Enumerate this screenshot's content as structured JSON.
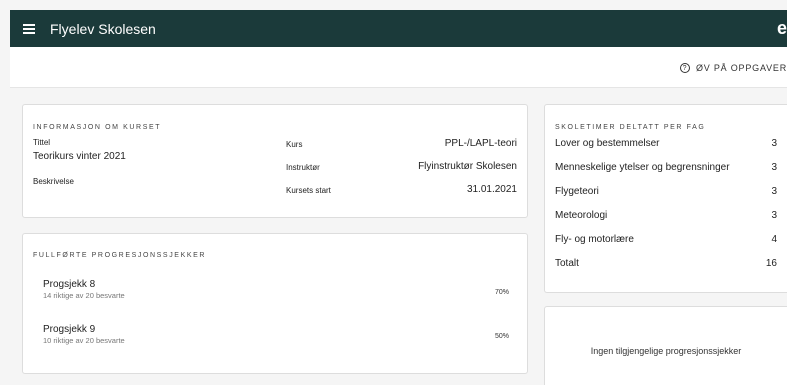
{
  "header": {
    "app_title": "Flyelev Skolesen",
    "logo_letter": "e"
  },
  "toolbar": {
    "practice_label": "ØV PÅ OPPGAVER"
  },
  "course_info": {
    "section_title": "INFORMASJON OM KURSET",
    "title_label": "Tittel",
    "title_value": "Teorikurs vinter 2021",
    "description_label": "Beskrivelse",
    "fields": [
      {
        "label": "Kurs",
        "value": "PPL-/LAPL-teori"
      },
      {
        "label": "Instruktør",
        "value": "Flyinstruktør Skolesen"
      },
      {
        "label": "Kursets start",
        "value": "31.01.2021"
      }
    ]
  },
  "progress_checks": {
    "section_title": "FULLFØRTE PROGRESJONSSJEKKER",
    "items": [
      {
        "name": "Progsjekk 8",
        "detail": "14 riktige av 20 besvarte",
        "percent_label": "70%",
        "percent": 70
      },
      {
        "name": "Progsjekk 9",
        "detail": "10 riktige av 20 besvarte",
        "percent_label": "50%",
        "percent": 50
      }
    ]
  },
  "school_hours": {
    "section_title": "SKOLETIMER DELTATT PER FAG",
    "rows": [
      {
        "subject": "Lover og bestemmelser",
        "count": "3"
      },
      {
        "subject": "Menneskelige ytelser og begrensninger",
        "count": "3"
      },
      {
        "subject": "Flygeteori",
        "count": "3"
      },
      {
        "subject": "Meteorologi",
        "count": "3"
      },
      {
        "subject": "Fly- og motorlære",
        "count": "4"
      }
    ],
    "total_label": "Totalt",
    "total_value": "16"
  },
  "empty_state": {
    "message": "Ingen tilgjengelige progresjonssjekker"
  }
}
